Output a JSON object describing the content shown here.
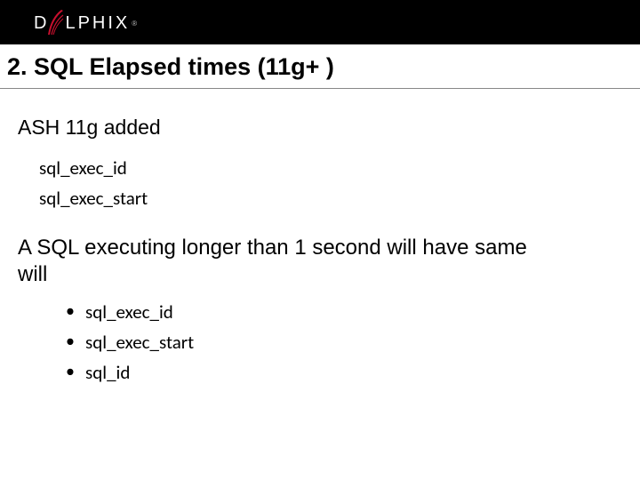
{
  "header": {
    "logo_left": "D",
    "logo_mid": "L",
    "logo_right": "PHIX",
    "logo_tm": "®"
  },
  "title": "2. SQL Elapsed times (11g+ )",
  "intro": "ASH 11g added",
  "added_cols": [
    "sql_exec_id",
    "sql_exec_start"
  ],
  "para2_line1": "A SQL executing longer than 1 second will have same",
  "para2_line2": "will",
  "same_cols": [
    "sql_exec_id",
    "sql_exec_start",
    "sql_id"
  ]
}
